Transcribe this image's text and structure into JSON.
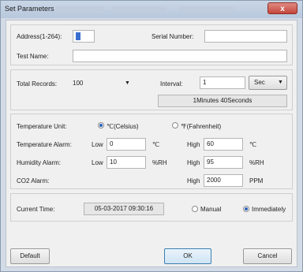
{
  "window": {
    "title": "Set Parameters",
    "close_label": "x"
  },
  "device": {
    "address_label": "Address(1-264):",
    "address_value": "1",
    "serial_label": "Serial Number:",
    "serial_value": "",
    "test_name_label": "Test Name:",
    "test_name_value": ""
  },
  "records": {
    "total_label": "Total Records:",
    "total_value": "100",
    "interval_label": "Interval:",
    "interval_value": "1",
    "interval_unit": "Sec",
    "duration_text": "1Minutes 40Seconds"
  },
  "alarms": {
    "temp_unit_label": "Temperature Unit:",
    "celsius_label": "℃(Celsius)",
    "fahrenheit_label": "℉(Fahrenheit)",
    "temp_alarm_label": "Temperature Alarm:",
    "humidity_alarm_label": "Humidity Alarm:",
    "co2_alarm_label": "CO2 Alarm:",
    "low_label": "Low",
    "high_label": "High",
    "temp_low": "0",
    "temp_high": "60",
    "temp_unit": "℃",
    "hum_low": "10",
    "hum_high": "95",
    "hum_unit": "%RH",
    "co2_high": "2000",
    "co2_unit": "PPM"
  },
  "time": {
    "label": "Current Time:",
    "value": "05-03-2017 09:30:16",
    "manual_label": "Manual",
    "immediately_label": "Immediately"
  },
  "buttons": {
    "default": "Default",
    "ok": "OK",
    "cancel": "Cancel"
  }
}
